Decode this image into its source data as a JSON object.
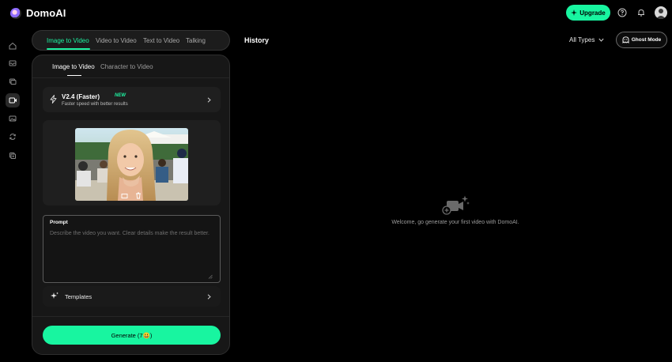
{
  "app": {
    "name": "DomoAI"
  },
  "topbar": {
    "upgrade_label": "Upgrade",
    "icons": [
      "help-icon",
      "bell-icon",
      "avatar"
    ]
  },
  "sidebar": {
    "icons": [
      "home-icon",
      "inbox-icon",
      "folder-icon",
      "video-icon",
      "image-icon",
      "refresh-icon",
      "copy-icon"
    ],
    "active_index": 3
  },
  "tabs": [
    {
      "label": "Image to Video",
      "active": true
    },
    {
      "label": "Video to Video",
      "active": false
    },
    {
      "label": "Text to Video",
      "active": false
    },
    {
      "label": "Talking",
      "active": false
    }
  ],
  "subtabs": [
    {
      "label": "Image to Video",
      "active": true
    },
    {
      "label": "Character to Video",
      "active": false
    }
  ],
  "model": {
    "name": "V2.4 (Faster)",
    "badge": "NEW",
    "description": "Faster speed with better results"
  },
  "prompt": {
    "label": "Prompt",
    "placeholder": "Describe the video you want. Clear details make the result better."
  },
  "templates": {
    "label": "Templates"
  },
  "generate": {
    "label": "Generate (7😃)"
  },
  "history": {
    "title": "History",
    "filter_label": "All Types",
    "ghost_mode_label": "Ghost Mode",
    "empty_message": "Welcome, go generate your first video with DomoAI."
  },
  "colors": {
    "accent": "#18f5a0",
    "background": "#000000",
    "panel": "#171717"
  }
}
